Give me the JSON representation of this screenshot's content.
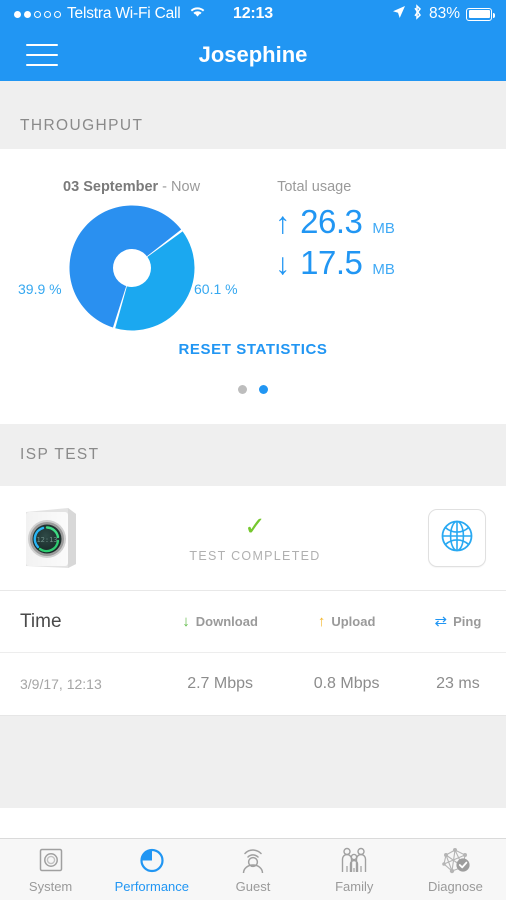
{
  "statusbar": {
    "carrier": "Telstra Wi-Fi Call",
    "signal_dots_filled": 2,
    "signal_dots_total": 5,
    "wifi_icon": "wifi-icon",
    "time": "12:13",
    "location_icon": "location-arrow-icon",
    "bluetooth_icon": "bluetooth-icon",
    "battery_percent": "83%",
    "battery_level": 83
  },
  "navbar": {
    "menu_icon": "hamburger-menu-icon",
    "title": "Josephine"
  },
  "throughput": {
    "section_title": "THROUGHPUT",
    "date_bold": "03 September",
    "date_rest": " - Now",
    "total_usage_label": "Total usage",
    "upload": {
      "arrow": "↑",
      "value": "26.3",
      "unit": "MB"
    },
    "download": {
      "arrow": "↓",
      "value": "17.5",
      "unit": "MB"
    },
    "pct_left": "39.9 %",
    "pct_right": "60.1 %",
    "reset_label": "RESET STATISTICS",
    "page_dots": 2,
    "active_dot": 1
  },
  "chart_data": {
    "type": "pie",
    "title": "Throughput split",
    "categories": [
      "Download",
      "Upload"
    ],
    "values": [
      39.9,
      60.1
    ],
    "labels": [
      "39.9 %",
      "60.1 %"
    ],
    "colors": [
      "#1BA8F0",
      "#2A90F0"
    ],
    "donut": true,
    "inner_radius_ratio": 0.3,
    "legend": "none",
    "units": "percent"
  },
  "isp_test": {
    "section_title": "ISP TEST",
    "device_icon": "router-device-icon",
    "check_icon": "check-icon",
    "status": "TEST COMPLETED",
    "globe_icon": "globe-icon"
  },
  "table": {
    "headers": {
      "time": "Time",
      "download": "Download",
      "upload": "Upload",
      "ping": "Ping"
    },
    "header_icons": {
      "download": "arrow-down-icon",
      "upload": "arrow-up-icon",
      "ping": "exchange-arrows-icon"
    },
    "rows": [
      {
        "time": "3/9/17, 12:13",
        "download": "2.7 Mbps",
        "upload": "0.8 Mbps",
        "ping": "23 ms"
      }
    ]
  },
  "tabbar": {
    "items": [
      {
        "label": "System",
        "icon": "system-icon",
        "active": false
      },
      {
        "label": "Performance",
        "icon": "performance-icon",
        "active": true
      },
      {
        "label": "Guest",
        "icon": "guest-icon",
        "active": false
      },
      {
        "label": "Family",
        "icon": "family-icon",
        "active": false
      },
      {
        "label": "Diagnose",
        "icon": "diagnose-icon",
        "active": false
      }
    ]
  },
  "colors": {
    "accent": "#2196F3",
    "chart_light": "#1BA8F0",
    "chart_dark": "#2A90F0",
    "success": "#76C82F",
    "download_arrow": "#5DBB46",
    "upload_arrow": "#F5B82E",
    "section_bg": "#EFEFEF"
  }
}
